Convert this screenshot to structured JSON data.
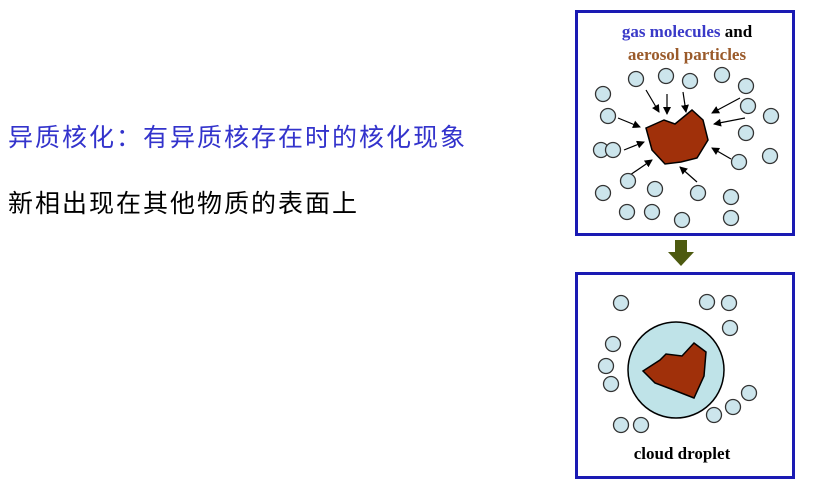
{
  "text": {
    "heading": "异质核化：有异质核存在时的核化现象",
    "subline": "新相出现在其他物质的表面上"
  },
  "top_panel": {
    "title_part1": "gas molecules",
    "title_part2": " and",
    "title_line2": "aerosol particles"
  },
  "bottom_panel": {
    "caption": "cloud droplet"
  },
  "colors": {
    "heading": "#3333cc",
    "frame": "#1a1ab3",
    "molecule_fill": "#cce5ec",
    "particle": "#a0300a",
    "title_blue": "#3a3ac8",
    "title_brown": "#9a5a2a",
    "droplet": "#bfe3e8",
    "arrow_down": "#4d5a10"
  }
}
